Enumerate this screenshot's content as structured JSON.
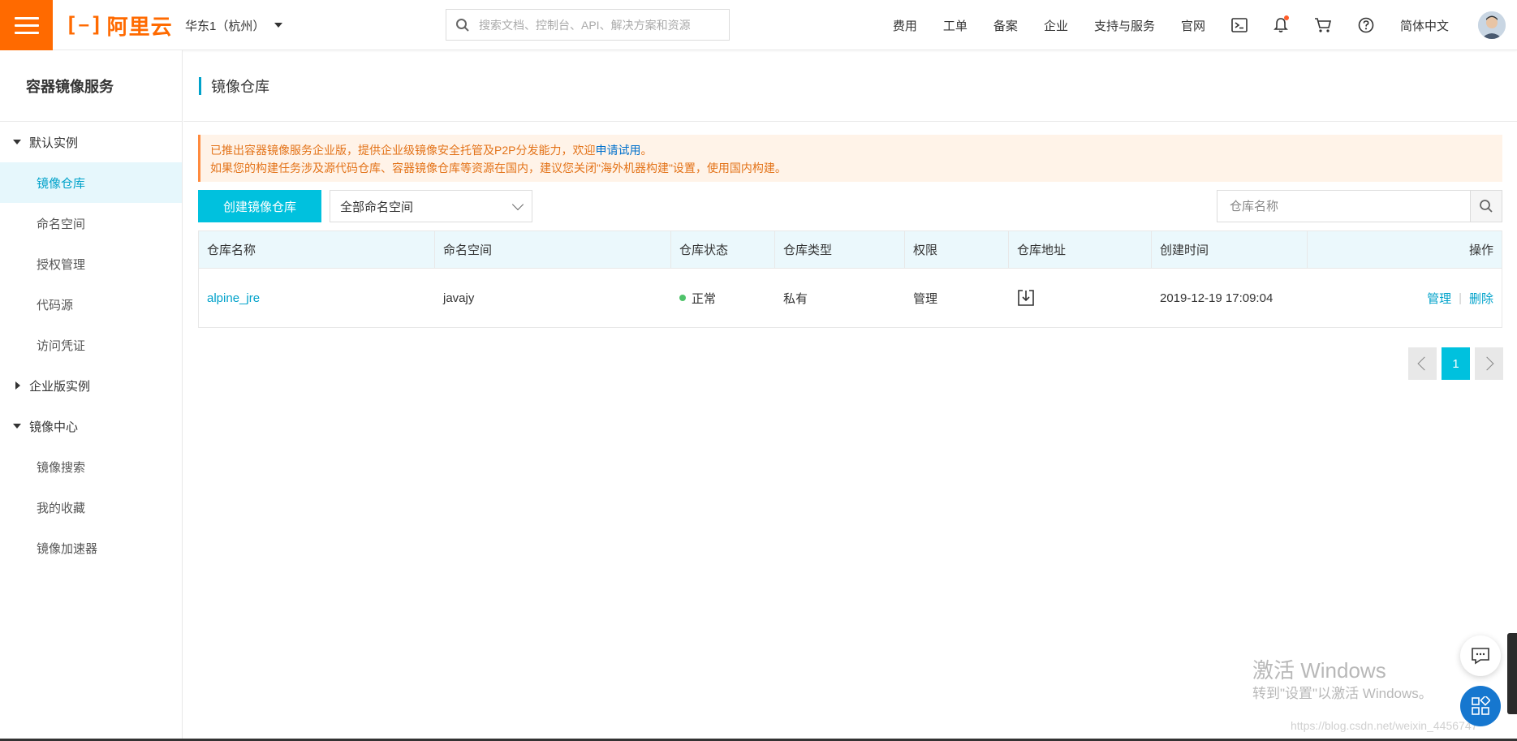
{
  "topbar": {
    "brand_text": "阿里云",
    "region": "华东1（杭州）",
    "search_placeholder": "搜索文档、控制台、API、解决方案和资源",
    "nav": [
      "费用",
      "工单",
      "备案",
      "企业",
      "支持与服务",
      "官网"
    ],
    "language": "简体中文",
    "brand_color": "#ff6a00"
  },
  "sidebar": {
    "title": "容器镜像服务",
    "groups": [
      {
        "label": "默认实例",
        "expanded": true,
        "items": [
          "镜像仓库",
          "命名空间",
          "授权管理",
          "代码源",
          "访问凭证"
        ]
      },
      {
        "label": "企业版实例",
        "expanded": false,
        "items": []
      },
      {
        "label": "镜像中心",
        "expanded": true,
        "items": [
          "镜像搜索",
          "我的收藏",
          "镜像加速器"
        ]
      }
    ],
    "active_item": "镜像仓库"
  },
  "main": {
    "page_title": "镜像仓库",
    "notice": {
      "line1_prefix": "已推出容器镜像服务企业版，提供企业级镜像安全托管及P2P分发能力，欢迎",
      "line1_link": "申请试用",
      "line1_suffix": "。",
      "line2": "如果您的构建任务涉及源代码仓库、容器镜像仓库等资源在国内，建议您关闭\"海外机器构建\"设置，使用国内构建。"
    },
    "create_button": "创建镜像仓库",
    "namespace_select": "全部命名空间",
    "repo_search_placeholder": "仓库名称",
    "table": {
      "columns": [
        "仓库名称",
        "命名空间",
        "仓库状态",
        "仓库类型",
        "权限",
        "仓库地址",
        "创建时间",
        "操作"
      ],
      "rows": [
        {
          "name": "alpine_jre",
          "namespace": "javajy",
          "status": "正常",
          "type": "私有",
          "permission": "管理",
          "created": "2019-12-19 17:09:04",
          "action_manage": "管理",
          "action_delete": "删除"
        }
      ]
    },
    "pagination": {
      "current": "1"
    }
  },
  "overlay": {
    "watermark_title": "激活 Windows",
    "watermark_sub": "转到\"设置\"以激活 Windows。",
    "url_watermark": "https://blog.csdn.net/weixin_4456747"
  },
  "colors": {
    "accent": "#00c1de",
    "link": "#00a2ca",
    "notice_text": "#e37319",
    "status_ok": "#4fc36a"
  }
}
